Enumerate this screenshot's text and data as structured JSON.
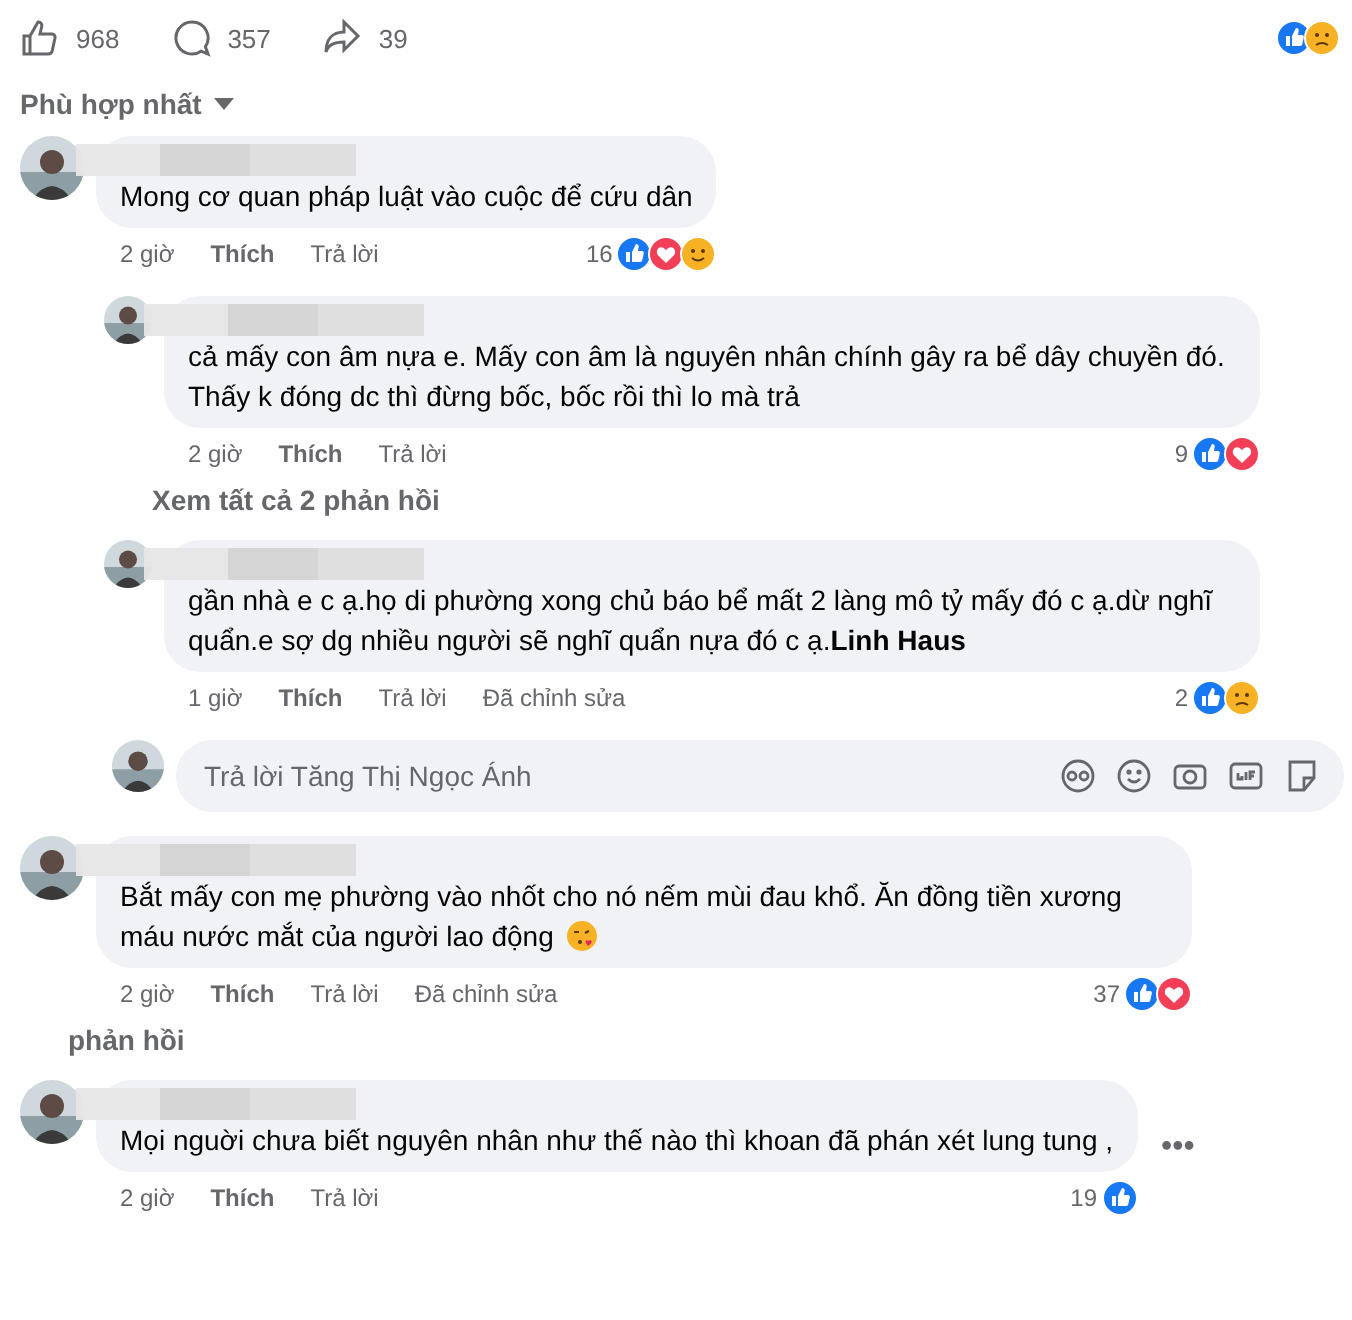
{
  "stats": {
    "likes": "968",
    "comments": "357",
    "shares": "39",
    "reactions": [
      {
        "kind": "like"
      },
      {
        "kind": "sad"
      }
    ]
  },
  "sort": {
    "label": "Phù hợp nhất"
  },
  "comments": [
    {
      "text": "Mong cơ quan pháp luật vào cuộc để cứu dân",
      "time": "2 giờ",
      "like": "Thích",
      "reply": "Trả lời",
      "count": "16",
      "reactions": [
        {
          "kind": "like"
        },
        {
          "kind": "love"
        },
        {
          "kind": "care"
        }
      ],
      "replies": [
        {
          "text": "cả mấy con âm nựa e. Mấy con âm là nguyên nhân chính gây ra bể dây chuyền đó. Thấy k đóng dc thì đừng bốc, bốc rồi thì lo mà trả",
          "time": "2 giờ",
          "like": "Thích",
          "reply": "Trả lời",
          "count": "9",
          "reactions": [
            {
              "kind": "like"
            },
            {
              "kind": "love"
            }
          ],
          "view_more": "Xem tất cả 2 phản hồi"
        },
        {
          "text": "gần nhà e c ạ.họ di phường xong chủ báo bể mất 2 làng mô tỷ mấy đó c ạ.dừ nghĩ quẩn.e sợ dg nhiều người sẽ nghĩ quẩn nựa đó c ạ.**Linh Haus**",
          "time": "1 giờ",
          "like": "Thích",
          "reply": "Trả lời",
          "edited": "Đã chỉnh sửa",
          "count": "2",
          "reactions": [
            {
              "kind": "like"
            },
            {
              "kind": "sad"
            }
          ]
        }
      ],
      "reply_box": {
        "placeholder": "Trả lời Tăng Thị Ngọc Ánh"
      }
    },
    {
      "text": "Bắt mấy con mẹ phường vào nhốt cho nó nếm mùi đau khổ. Ăn đồng tiền xương máu nước mắt của người lao động",
      "emoji": true,
      "time": "2 giờ",
      "like": "Thích",
      "reply": "Trả lời",
      "edited": "Đã chỉnh sửa",
      "count": "37",
      "reactions": [
        {
          "kind": "like"
        },
        {
          "kind": "love"
        }
      ],
      "view_more": "phản hồi"
    },
    {
      "text": "Mọi nguời chưa biết nguyên nhân như thế nào thì khoan đã phán xét lung tung ,",
      "time": "2 giờ",
      "like": "Thích",
      "reply": "Trả lời",
      "count": "19",
      "reactions": [
        {
          "kind": "like"
        }
      ],
      "more": "•••"
    }
  ]
}
